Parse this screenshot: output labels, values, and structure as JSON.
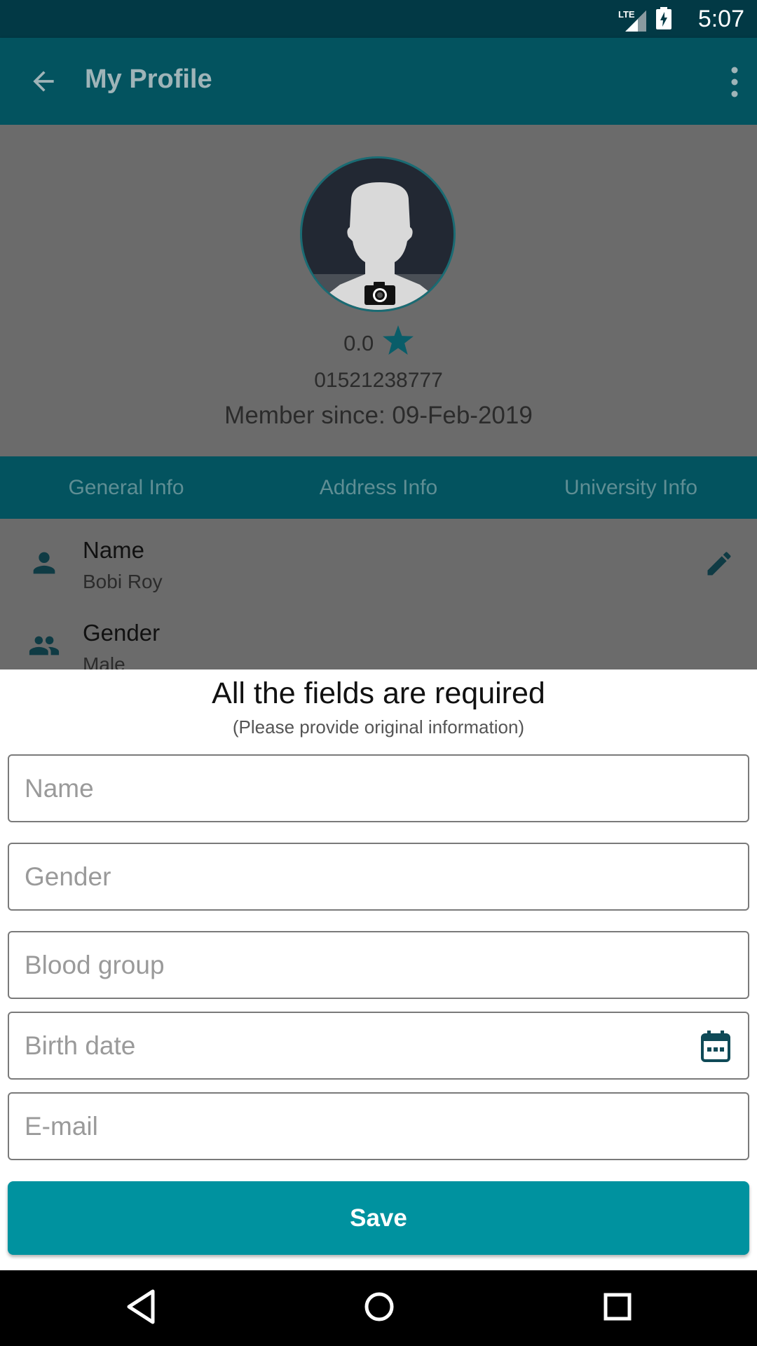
{
  "status_bar": {
    "time": "5:07",
    "network": "LTE"
  },
  "app_bar": {
    "title": "My Profile",
    "back_icon": "arrow-back-icon",
    "more_icon": "more-vert-icon"
  },
  "profile": {
    "rating": "0.0",
    "phone": "01521238777",
    "member_since": "Member since: 09-Feb-2019"
  },
  "tabs": [
    {
      "label": "General Info"
    },
    {
      "label": "Address Info"
    },
    {
      "label": "University Info"
    }
  ],
  "info": [
    {
      "label": "Name",
      "value": "Bobi Roy",
      "icon": "person-icon"
    },
    {
      "label": "Gender",
      "value": "Male",
      "icon": "people-icon"
    }
  ],
  "sheet": {
    "heading": "All the fields are required",
    "subheading": "(Please provide original information)",
    "fields": {
      "name_placeholder": "Name",
      "gender_placeholder": "Gender",
      "blood_placeholder": "Blood group",
      "birth_placeholder": "Birth date",
      "email_placeholder": "E-mail"
    },
    "save_label": "Save"
  },
  "colors": {
    "app_bar": "#03535f",
    "status_bar": "#023945",
    "accent": "#00929f",
    "star": "#0a5d69"
  }
}
